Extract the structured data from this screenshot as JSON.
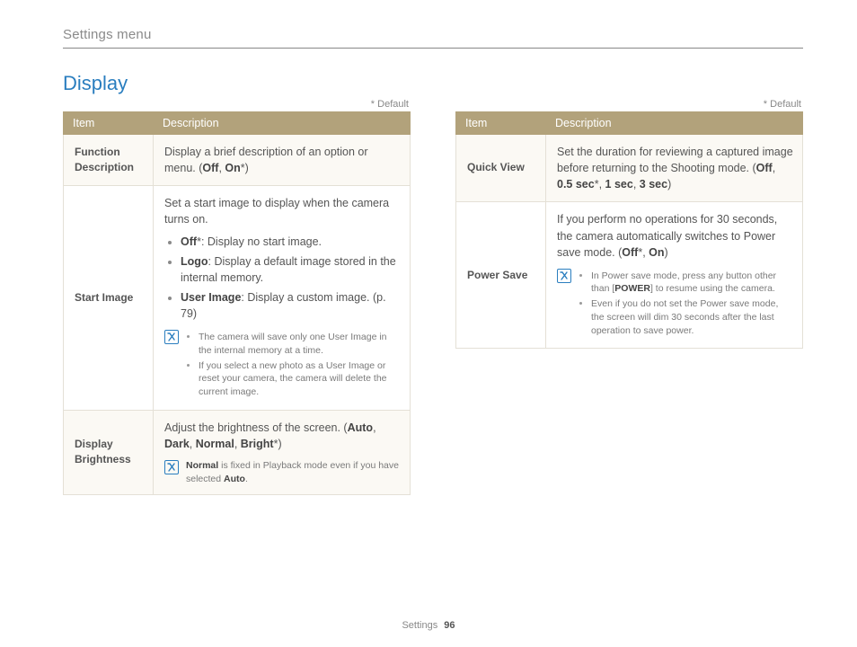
{
  "breadcrumb": "Settings menu",
  "section_title": "Display",
  "default_note": "* Default",
  "headers": {
    "item": "Item",
    "desc": "Description"
  },
  "footer": {
    "section": "Settings",
    "page": "96"
  },
  "left": {
    "rows": [
      {
        "item": "Function Description",
        "desc_pre": "Display a brief description of an option or menu. (",
        "opt1": "Off",
        "sep1": ", ",
        "opt2": "On",
        "star": "*",
        "desc_post": ")"
      },
      {
        "item": "Start Image",
        "intro": "Set a start image to display when the camera turns on.",
        "b1_bold": "Off",
        "b1_star": "*",
        "b1_rest": ": Display no start image.",
        "b2_bold": "Logo",
        "b2_rest": ": Display a default image stored in the internal memory.",
        "b3_bold": "User Image",
        "b3_rest": ": Display a custom image. (p. 79)",
        "note1": "The camera will save only one User Image in the internal memory at a time.",
        "note2": "If you select a new photo as a User Image or reset your camera, the camera will delete the current image."
      },
      {
        "item": "Display Brightness",
        "intro_pre": "Adjust the brightness of the screen. (",
        "o1": "Auto",
        "s1": ", ",
        "o2": "Dark",
        "s2": ", ",
        "o3": "Normal",
        "s3": ", ",
        "o4": "Bright",
        "star": "*",
        "intro_post": ")",
        "note_b1": "Normal",
        "note_mid": " is fixed in Playback mode even if you have selected ",
        "note_b2": "Auto",
        "note_end": "."
      }
    ]
  },
  "right": {
    "rows": [
      {
        "item": "Quick View",
        "pre": "Set the duration for reviewing a captured image before returning to the Shooting mode. (",
        "o1": "Off",
        "s1": ", ",
        "o2": "0.5 sec",
        "star": "*",
        "s2": ", ",
        "o3": "1 sec",
        "s3": ", ",
        "o4": "3 sec",
        "post": ")"
      },
      {
        "item": "Power Save",
        "intro_pre": "If you perform no operations for 30 seconds, the camera automatically switches to Power save mode. (",
        "o1": "Off",
        "star": "*",
        "s1": ", ",
        "o2": "On",
        "intro_post": ")",
        "note1_pre": "In Power save mode, press any button other than [",
        "note1_bold": "POWER",
        "note1_post": "] to resume using the camera.",
        "note2": "Even if you do not set the Power save mode, the screen will dim 30 seconds after the last operation to save power."
      }
    ]
  }
}
